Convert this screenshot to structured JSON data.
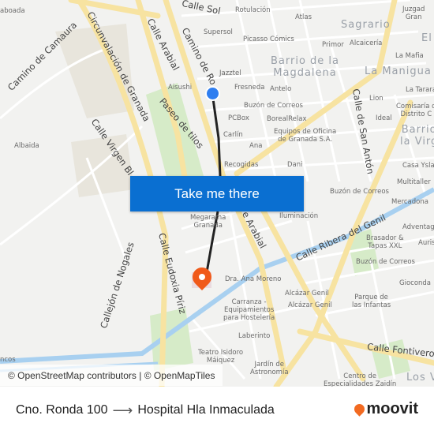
{
  "map": {
    "labels": {
      "taboada": "aboada",
      "calle_sol": "Calle Sol",
      "rotulacion": "Rotulación",
      "atlas": "Atlas",
      "juzgados": "Juzgad\nGran",
      "circunvalacion": "Circunvalación de Granada",
      "camino_camaura": "Camino de Camaura",
      "calle_arabial": "Calle Arabial",
      "camino_ronda": "Camino de Ro",
      "supersol": "Supersol",
      "picasso": "Picasso Cómics",
      "sagrario": "Sagrario",
      "el": "El",
      "primor": "Primor",
      "alcaiceria": "Alcaicería",
      "barrio_magdalena": "Barrio de la\nMagdalena",
      "la_mafia": "La Mafia",
      "la_manigua": "La Manigua",
      "jazztel": "Jazztel",
      "aisushi": "Aisushi",
      "fresneda": "Fresneda",
      "antelo": "Antelo",
      "la_tarara": "La Tarara",
      "lion": "Lion",
      "buzon1": "Buzón de Correos",
      "comisaria": "Comisaría d\nDistrito C",
      "paseo_tilos": "Paseo de tilos",
      "pcbox": "PCBox",
      "boreal": "BorealRelax",
      "ideal": "Ideal",
      "barrio_virgen": "Barrio\nla Virg",
      "calle_san_anton": "Calle de San Antón",
      "albaida": "Albaida",
      "calle_virgen": "Calle Virgen Bl",
      "carlin": "Carlín",
      "equipos": "Equipos de Oficina\nde Granada S.A.",
      "ana": "Ana",
      "recogidas": "Recogidas",
      "dani": "Dani",
      "casa_ysla": "Casa Ysla",
      "multitaller": "Multitaller",
      "buzon2": "Buzón de Correos",
      "mercadona": "Mercadona",
      "iluminacion": "da\nIluminación",
      "megarama": "Megarama\nGranada",
      "arabial2": "e Arabial",
      "ribera": "Calle Ribera del Genil",
      "adventag": "Adventag",
      "brasador": "Brasador &\nTapas XXL",
      "auris": "Auris",
      "buzon3": "Buzón de Correos",
      "calle_eudoxia": "Calle Eudoxia Píriz",
      "callejon_nogales": "Callejón de Nogales",
      "dra_ana": "Dra. Ana Moreno",
      "gioconda": "Gioconda",
      "alcazar1": "Alcázar Genil",
      "alcazar2": "Alcázar Genil",
      "parque": "Parque de\nlas Infantas",
      "carranza": "Carranza -\nEquipamientos\npara Hostelería",
      "laberinto": "Laberinto",
      "fontiveros": "Calle Fontiveros",
      "teatro": "Teatro Isidoro\nMáiquez",
      "jardin": "Jardín de\nAstronomía",
      "centro": "Centro de\nEspecialidades Zaidín",
      "los_v": "Los V",
      "ncos": "ncos"
    },
    "colors": {
      "major_road": "#f7e3a1",
      "water": "#a8d0f0",
      "park": "#d6ebc8",
      "route": "#222222",
      "origin": "#2f7ef0",
      "destination": "#f05a1a"
    }
  },
  "cta": {
    "label": "Take me there"
  },
  "attribution": "© OpenStreetMap contributors | © OpenMapTiles",
  "footer": {
    "origin": "Cno. Ronda 100",
    "arrow": "⟶",
    "destination": "Hospital Hla Inmaculada",
    "brand": "moovit"
  }
}
